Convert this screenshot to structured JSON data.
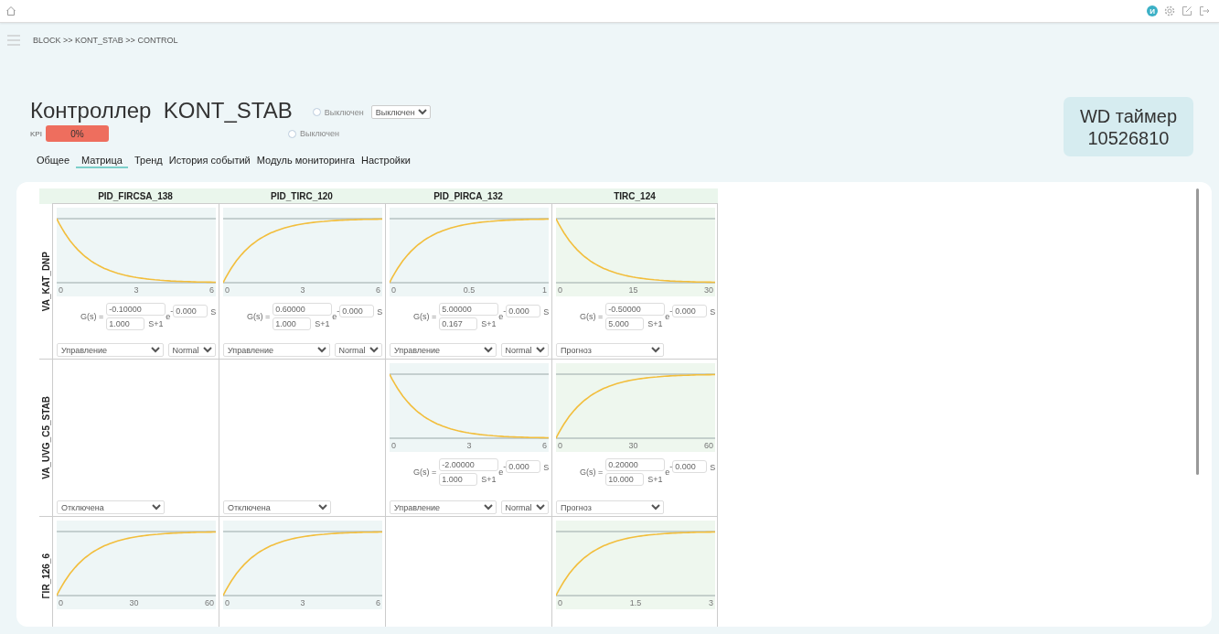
{
  "topbar": {
    "avatar": "И"
  },
  "breadcrumb": "BLOCK >> KONT_STAB >> CONTROL",
  "header": {
    "title": "Контроллер  KONT_STAB",
    "kpi_label": "KPI",
    "kpi_value": "0%",
    "radios": [
      {
        "label": "Выключен",
        "checked": false
      },
      {
        "label": "Выключен",
        "checked": false
      }
    ],
    "state_select": "Выключен"
  },
  "wd_timer": {
    "label": "WD таймер",
    "value": "10526810"
  },
  "tabs": [
    {
      "label": "Общее",
      "selected": false
    },
    {
      "label": "Матрица",
      "selected": true
    },
    {
      "label": "Тренд",
      "selected": false
    },
    {
      "label": "История событий",
      "selected": false
    },
    {
      "label": "Модуль мониторинга",
      "selected": false
    },
    {
      "label": "Настройки",
      "selected": false
    }
  ],
  "matrix": {
    "columns": [
      {
        "name": "PID_FIRCSA_138",
        "color": "#eef6f6"
      },
      {
        "name": "PID_TIRC_120",
        "color": "#eef6f6"
      },
      {
        "name": "PID_PIRCA_132",
        "color": "#eef6f6"
      },
      {
        "name": "TIRC_124",
        "color": "#eef7ee"
      }
    ],
    "rows": [
      {
        "name": "VA_KAT_DNP",
        "cells": [
          {
            "kind": "model",
            "chart": {
              "kind": "fall",
              "xticks": [
                "0",
                "3",
                "6"
              ]
            },
            "formula": {
              "lhs": "G(s) =",
              "gain": "-0.10000",
              "tau": "1.000",
              "suffix": "S+1",
              "exp_sign": "-",
              "exp_base": "e",
              "delay": "0.000",
              "delay_unit": "S"
            },
            "mode": "Управление",
            "signal": "Normal"
          },
          {
            "kind": "model",
            "chart": {
              "kind": "rise",
              "xticks": [
                "0",
                "3",
                "6"
              ]
            },
            "formula": {
              "lhs": "G(s) =",
              "gain": "0.60000",
              "tau": "1.000",
              "suffix": "S+1",
              "exp_sign": "-",
              "exp_base": "e",
              "delay": "0.000",
              "delay_unit": "S"
            },
            "mode": "Управление",
            "signal": "Normal"
          },
          {
            "kind": "model",
            "chart": {
              "kind": "rise",
              "xticks": [
                "0",
                "0.5",
                "1"
              ]
            },
            "formula": {
              "lhs": "G(s) =",
              "gain": "5.00000",
              "tau": "0.167",
              "suffix": "S+1",
              "exp_sign": "-",
              "exp_base": "e",
              "delay": "0.000",
              "delay_unit": "S"
            },
            "mode": "Управление",
            "signal": "Normal"
          },
          {
            "kind": "model",
            "chart": {
              "kind": "fall",
              "xticks": [
                "0",
                "15",
                "30"
              ]
            },
            "formula": {
              "lhs": "G(s) =",
              "gain": "-0.50000",
              "tau": "5.000",
              "suffix": "S+1",
              "exp_sign": "-",
              "exp_base": "e",
              "delay": "0.000",
              "delay_unit": "S"
            },
            "mode": "Прогноз"
          }
        ]
      },
      {
        "name": "VA_UVG_C5_STAB",
        "cells": [
          {
            "kind": "off",
            "mode": "Отключена"
          },
          {
            "kind": "off",
            "mode": "Отключена"
          },
          {
            "kind": "model",
            "chart": {
              "kind": "fall",
              "xticks": [
                "0",
                "3",
                "6"
              ]
            },
            "formula": {
              "lhs": "G(s) =",
              "gain": "-2.00000",
              "tau": "1.000",
              "suffix": "S+1",
              "exp_sign": "-",
              "exp_base": "e",
              "delay": "0.000",
              "delay_unit": "S"
            },
            "mode": "Управление",
            "signal": "Normal"
          },
          {
            "kind": "model",
            "chart": {
              "kind": "rise",
              "xticks": [
                "0",
                "30",
                "60"
              ]
            },
            "formula": {
              "lhs": "G(s) =",
              "gain": "0.20000",
              "tau": "10.000",
              "suffix": "S+1",
              "exp_sign": "-",
              "exp_base": "e",
              "delay": "0.000",
              "delay_unit": "S"
            },
            "mode": "Прогноз"
          }
        ]
      },
      {
        "name": "ΓIR_126_6",
        "cells": [
          {
            "kind": "chart",
            "chart": {
              "kind": "rise",
              "xticks": [
                "0",
                "30",
                "60"
              ]
            }
          },
          {
            "kind": "chart",
            "chart": {
              "kind": "rise",
              "xticks": [
                "0",
                "3",
                "6"
              ]
            }
          },
          {
            "kind": "empty"
          },
          {
            "kind": "chart",
            "chart": {
              "kind": "rise",
              "xticks": [
                "0",
                "1.5",
                "3"
              ]
            }
          }
        ]
      }
    ]
  }
}
